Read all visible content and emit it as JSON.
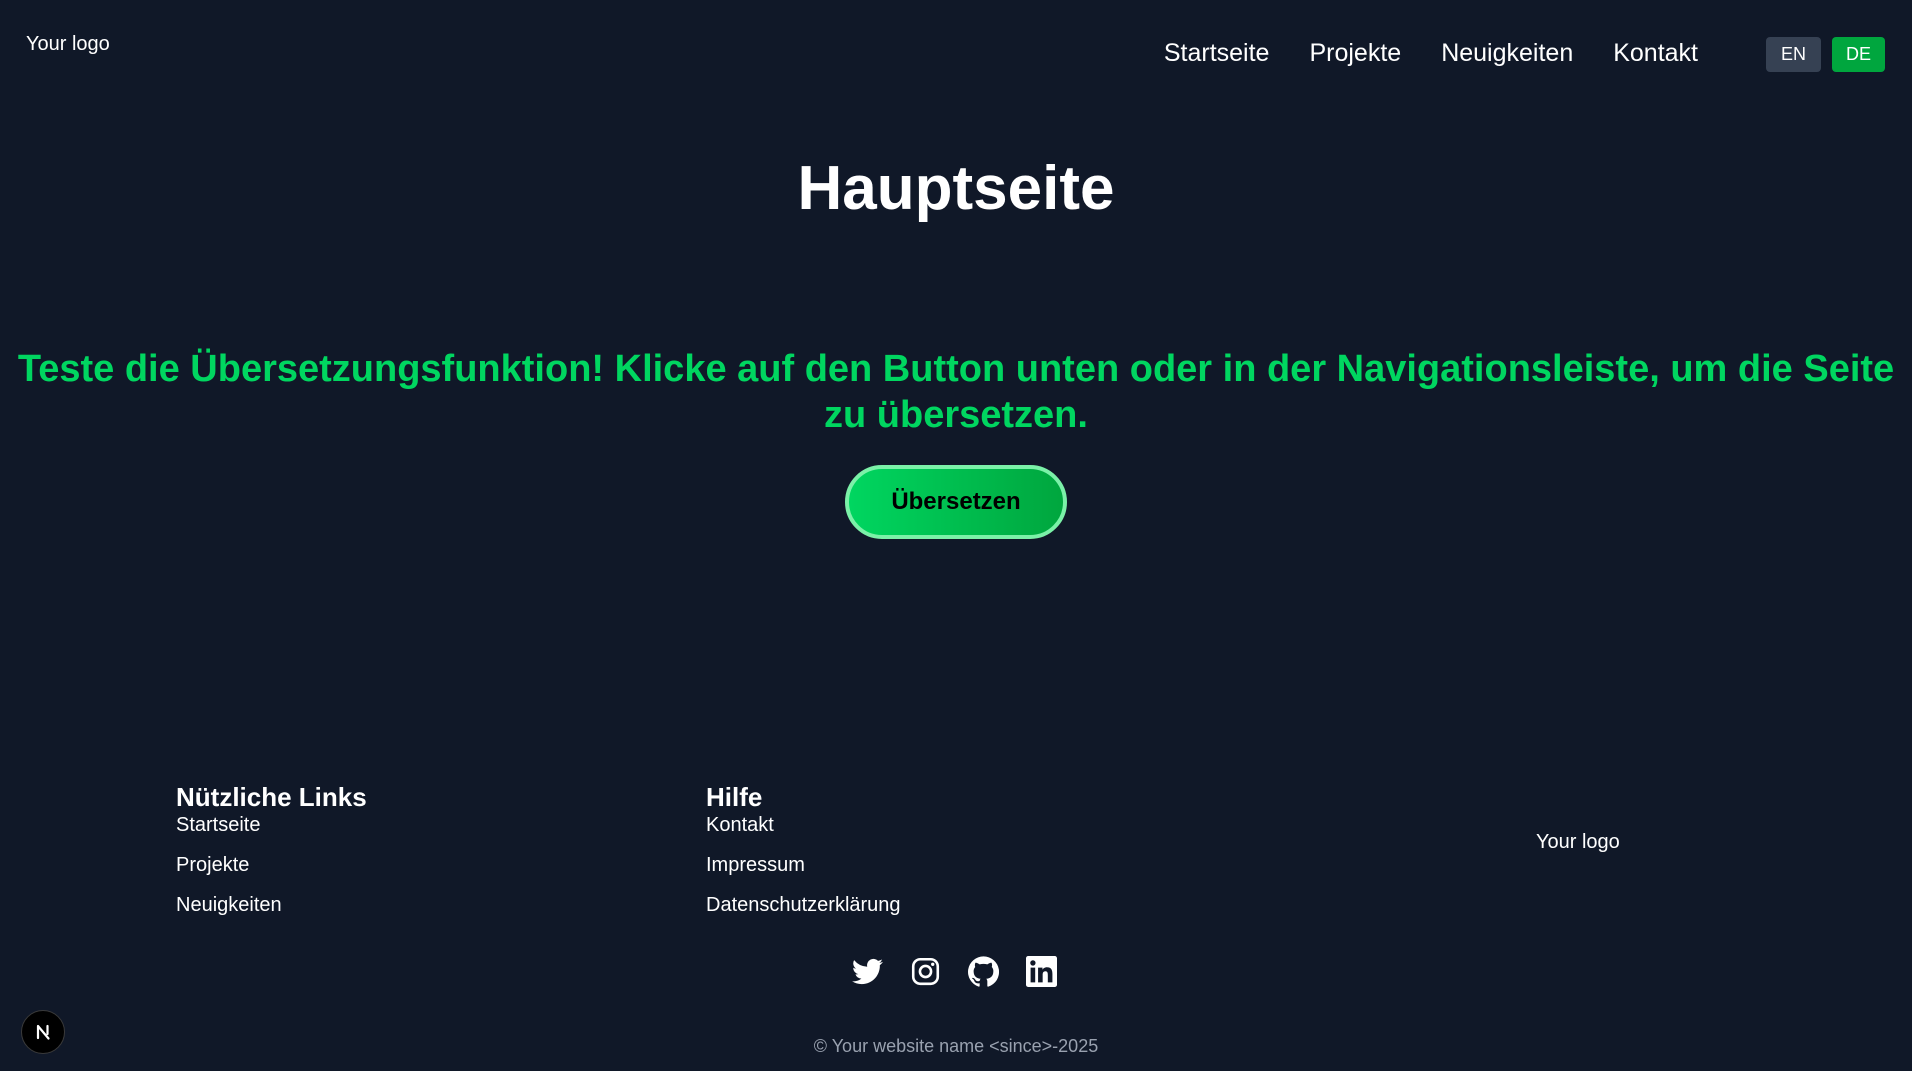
{
  "header": {
    "logo": "Your logo",
    "nav": [
      {
        "label": "Startseite"
      },
      {
        "label": "Projekte"
      },
      {
        "label": "Neuigkeiten"
      },
      {
        "label": "Kontakt"
      }
    ],
    "languages": [
      {
        "label": "EN",
        "active": false
      },
      {
        "label": "DE",
        "active": true
      }
    ]
  },
  "main": {
    "title": "Hauptseite",
    "cta_text": "Teste die Übersetzungsfunktion! Klicke auf den Button unten oder in der Navigationsleiste, um die Seite zu übersetzen.",
    "button_label": "Übersetzen"
  },
  "footer": {
    "links_column": {
      "heading": "Nützliche Links",
      "items": [
        "Startseite",
        "Projekte",
        "Neuigkeiten"
      ]
    },
    "help_column": {
      "heading": "Hilfe",
      "items": [
        "Kontakt",
        "Impressum",
        "Datenschutzerklärung"
      ]
    },
    "logo": "Your logo",
    "social_icons": [
      "twitter-icon",
      "instagram-icon",
      "github-icon",
      "linkedin-icon"
    ],
    "copyright": "© Your website name <since>-2025"
  },
  "dev_badge": {
    "icon": "nextjs-icon"
  },
  "colors": {
    "background": "#101828",
    "accent_green": "#00d660",
    "button_border": "#7bf1a8",
    "lang_active": "#00a63e",
    "lang_inactive": "#364153",
    "copyright_text": "#99a1af"
  }
}
